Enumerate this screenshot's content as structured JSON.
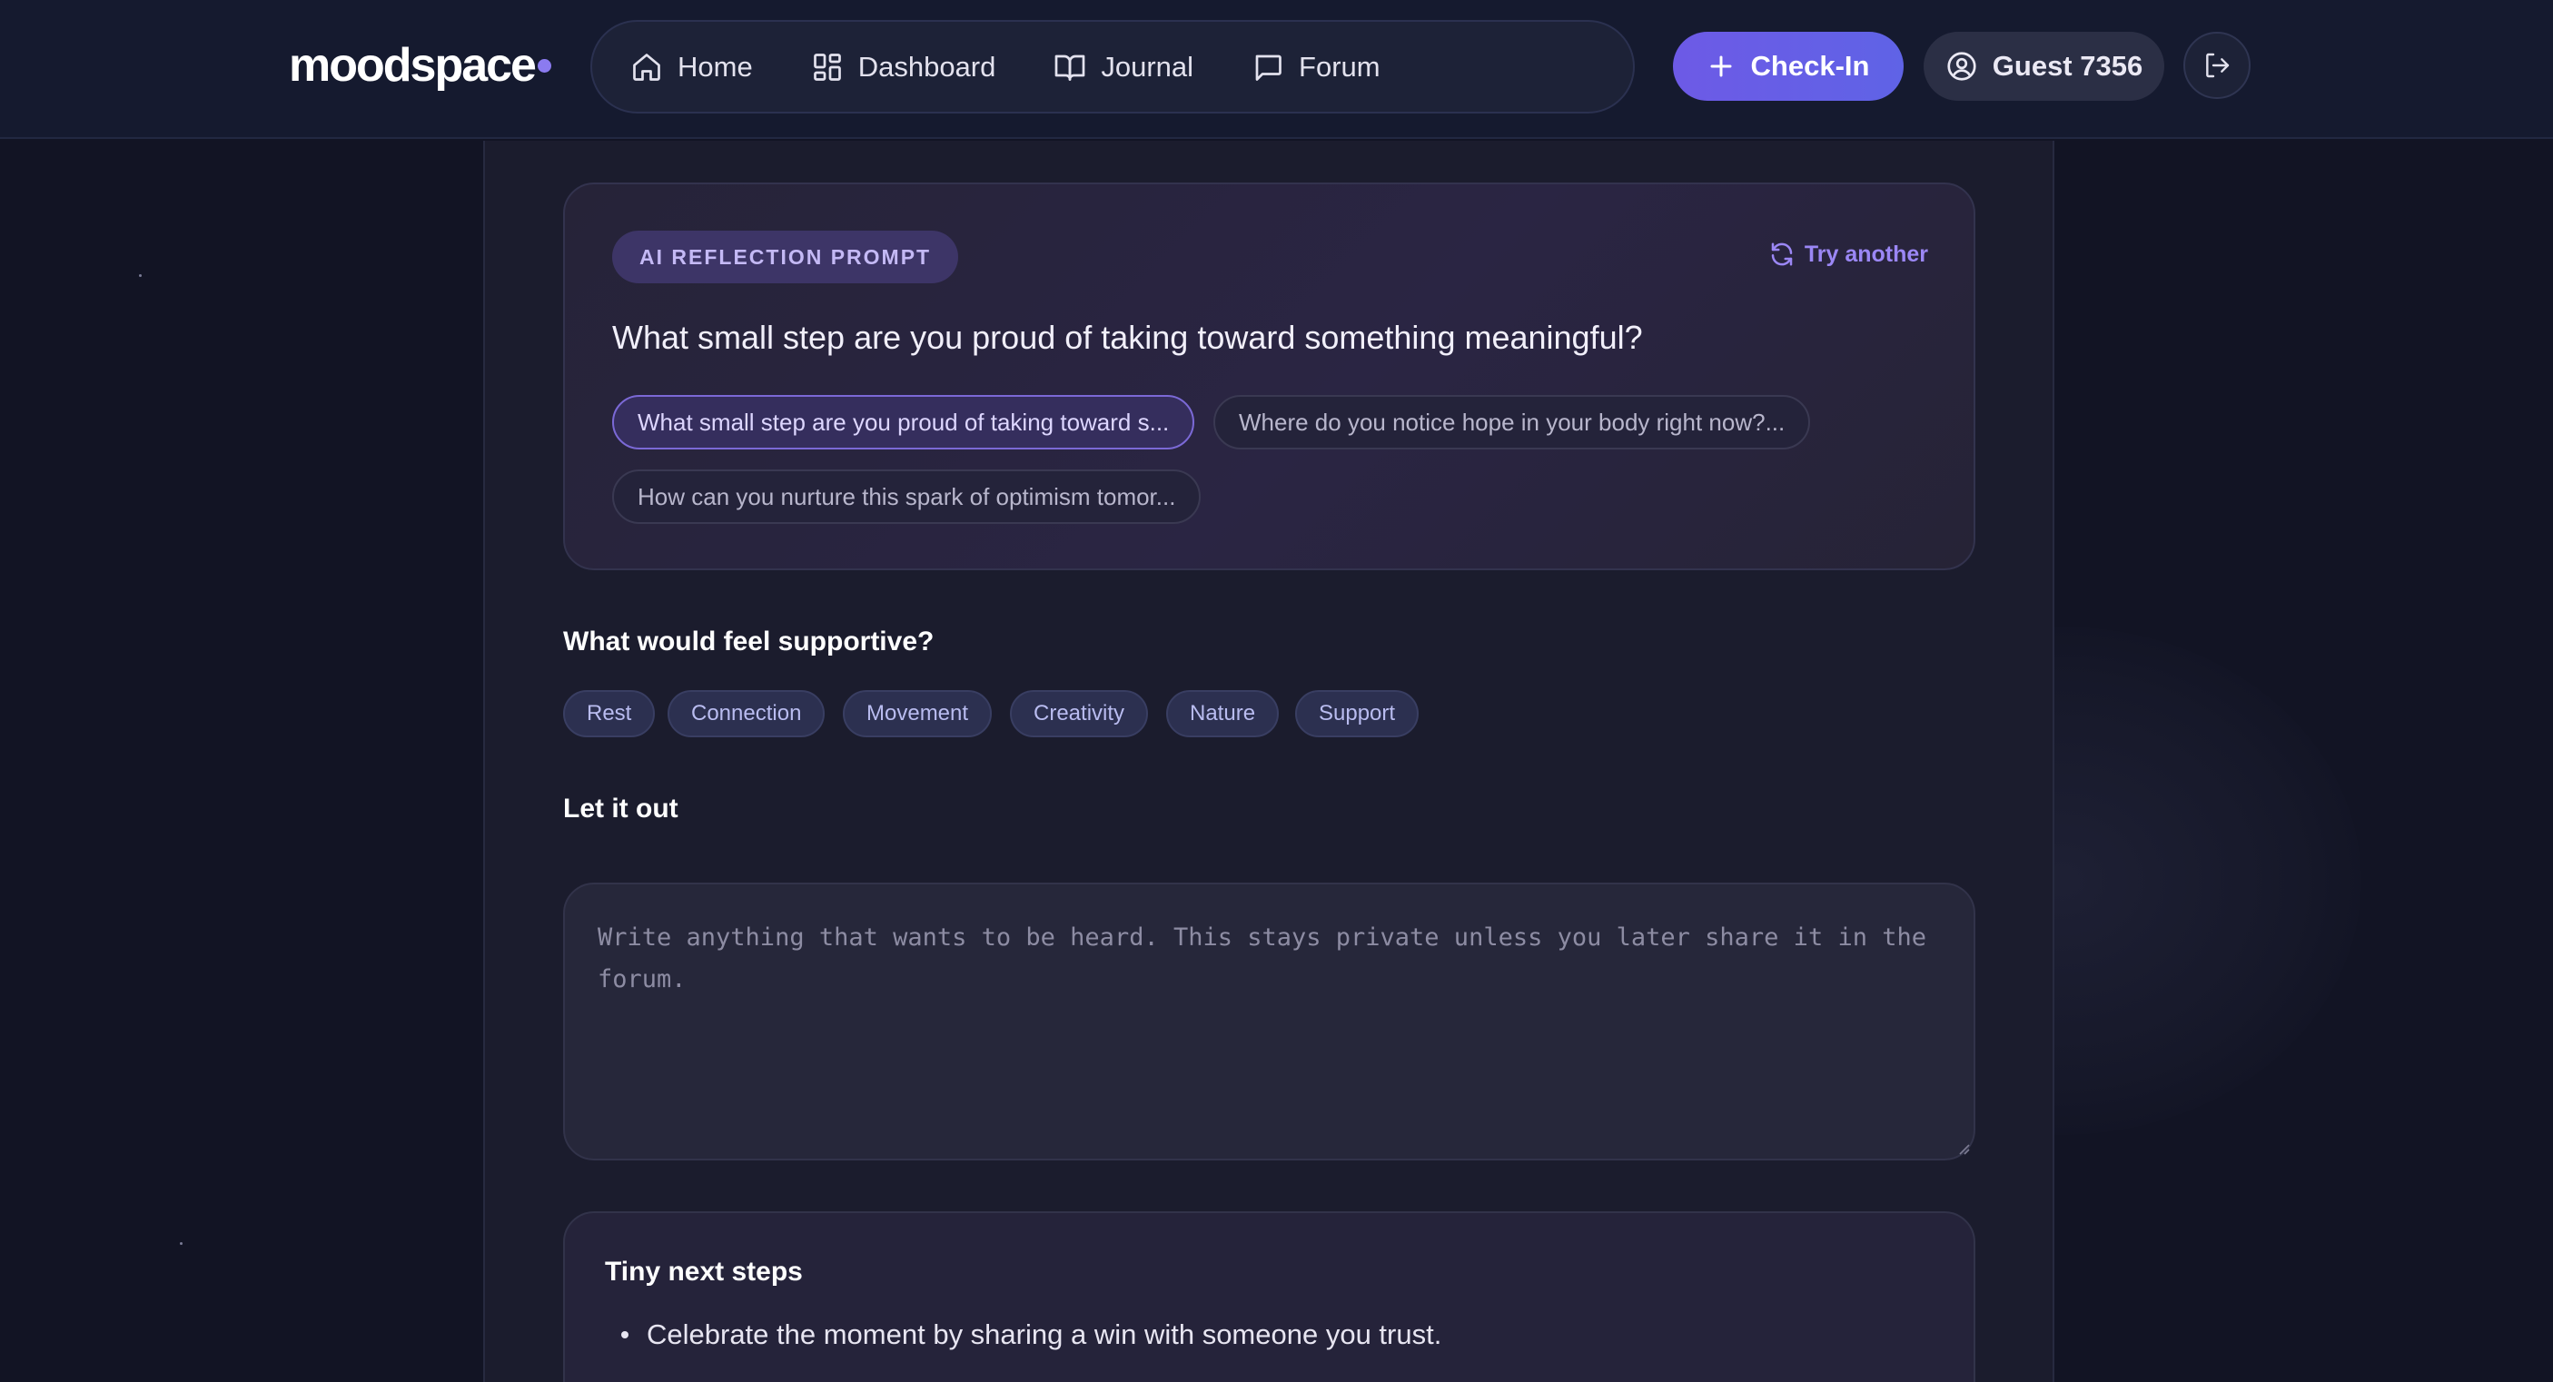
{
  "brand": {
    "name": "moodspace",
    "accent": "#8b7bf0"
  },
  "nav": {
    "items": [
      {
        "label": "Home",
        "icon": "home-icon"
      },
      {
        "label": "Dashboard",
        "icon": "dashboard-icon"
      },
      {
        "label": "Journal",
        "icon": "book-icon"
      },
      {
        "label": "Forum",
        "icon": "chat-icon"
      }
    ],
    "checkin_label": "Check-In",
    "guest_label": "Guest 7356",
    "logout_icon": "logout-icon"
  },
  "prompt": {
    "badge": "AI REFLECTION PROMPT",
    "try_another": "Try another",
    "question": "What small step are you proud of taking toward something meaningful?",
    "suggestions": [
      "What small step are you proud of taking toward s...",
      "Where do you notice hope in your body right now?...",
      "How can you nurture this spark of optimism tomor..."
    ]
  },
  "supportive": {
    "title": "What would feel supportive?",
    "tags": [
      "Rest",
      "Connection",
      "Movement",
      "Creativity",
      "Nature",
      "Support"
    ]
  },
  "journal": {
    "title": "Let it out",
    "placeholder": "Write anything that wants to be heard. This stays private unless you later share it in the forum."
  },
  "next_steps": {
    "title": "Tiny next steps",
    "items": [
      "Celebrate the moment by sharing a win with someone you trust."
    ]
  }
}
